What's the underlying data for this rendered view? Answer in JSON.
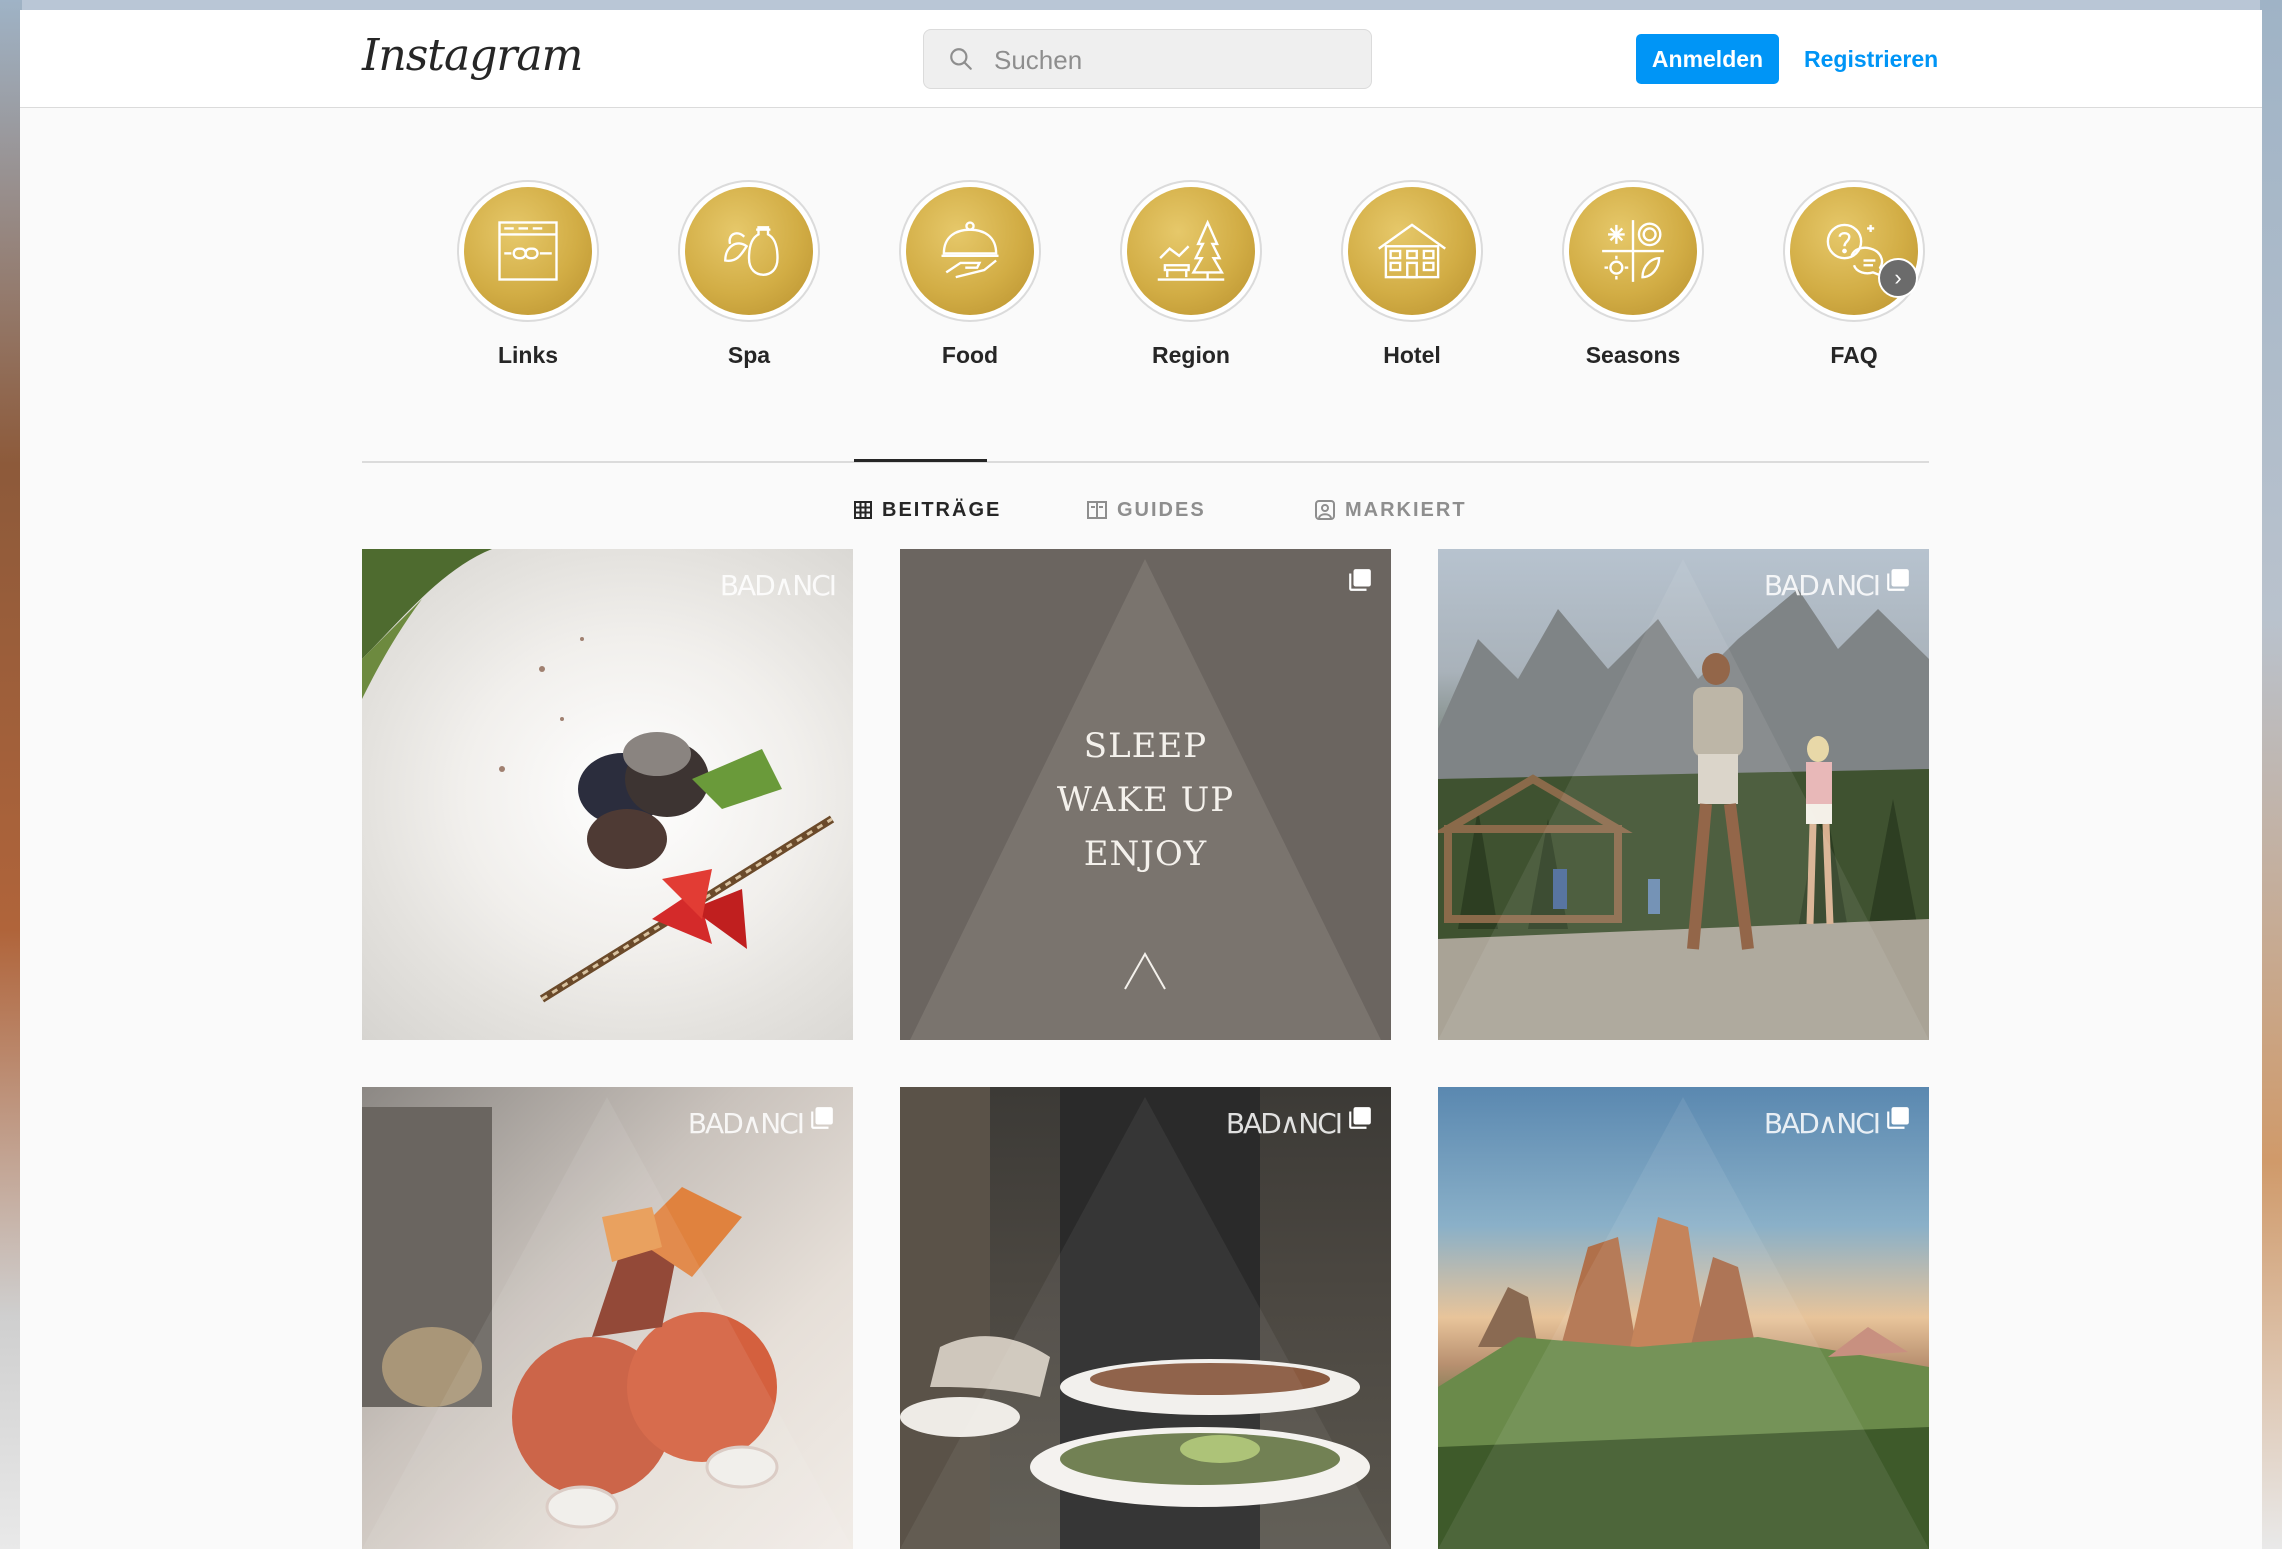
{
  "header": {
    "logo_text": "Instagram",
    "search_placeholder": "Suchen",
    "login_label": "Anmelden",
    "register_label": "Registrieren"
  },
  "highlights": [
    {
      "label": "Links",
      "icon": "browser-link-icon"
    },
    {
      "label": "Spa",
      "icon": "spa-leaf-bottle-icon"
    },
    {
      "label": "Food",
      "icon": "cloche-hand-icon"
    },
    {
      "label": "Region",
      "icon": "tree-bench-landscape-icon"
    },
    {
      "label": "Hotel",
      "icon": "hotel-building-icon"
    },
    {
      "label": "Seasons",
      "icon": "four-seasons-icon"
    },
    {
      "label": "FAQ",
      "icon": "speech-bubble-question-icon"
    }
  ],
  "tabs": [
    {
      "label": "BEITRÄGE",
      "icon": "grid-icon",
      "active": true
    },
    {
      "label": "GUIDES",
      "icon": "guide-icon",
      "active": false
    },
    {
      "label": "MARKIERT",
      "icon": "tagged-icon",
      "active": false
    }
  ],
  "posts": [
    {
      "type": "photo",
      "subject": "dessert plate with strawberries",
      "watermark": "BAD∧NCI",
      "multi": false
    },
    {
      "type": "graphic",
      "lines": [
        "SLEEP",
        "WAKE UP",
        "ENJOY"
      ],
      "multi": true
    },
    {
      "type": "photo",
      "subject": "hikers in mountain valley",
      "watermark": "BAD∧NCI",
      "multi": true
    },
    {
      "type": "photo",
      "subject": "orange spa bottles",
      "watermark": "BAD∧NCI",
      "multi": true
    },
    {
      "type": "photo",
      "subject": "waiter carrying plates",
      "watermark": "BAD∧NCI",
      "multi": true
    },
    {
      "type": "photo",
      "subject": "Tre Cime mountain sunset",
      "watermark": "BAD∧NCI",
      "multi": true
    }
  ],
  "colors": {
    "accent": "#0095f6",
    "gold": "#d2ad45",
    "graphic_bg": "#6b6560"
  }
}
